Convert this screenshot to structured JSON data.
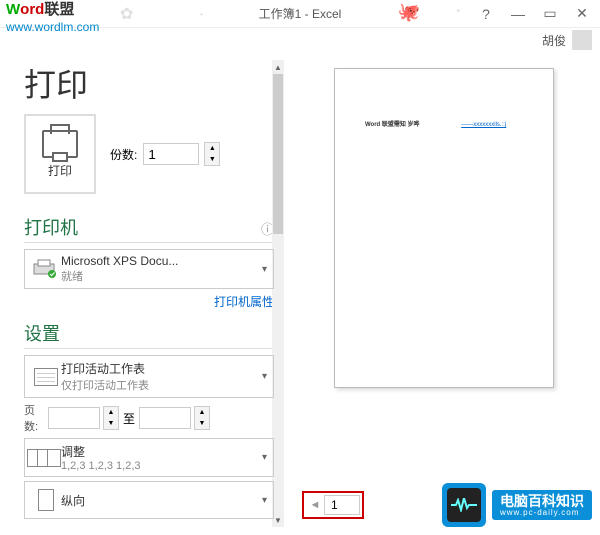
{
  "window": {
    "title": "工作簿1 - Excel",
    "help": "?",
    "min": "—",
    "restore": "▭",
    "close": "✕"
  },
  "user": {
    "name": "胡俊"
  },
  "page": {
    "heading": "打印",
    "print_button": "打印",
    "copies_label": "份数:",
    "copies_value": "1"
  },
  "printer_section": {
    "title": "打印机",
    "selected": "Microsoft XPS Docu...",
    "status": "就绪",
    "properties_link": "打印机属性"
  },
  "settings_section": {
    "title": "设置",
    "scope": {
      "main": "打印活动工作表",
      "sub": "仅打印活动工作表"
    },
    "pages": {
      "label": "页数:",
      "to": "至"
    },
    "collate": {
      "main": "调整",
      "sub": "1,2,3   1,2,3   1,2,3"
    },
    "orientation": {
      "main": "纵向"
    }
  },
  "preview": {
    "line1": "Word 联盟需知 岁哗",
    "line2": "——xxxxxxxlls.::j",
    "page_current": "1",
    "nav_prev": "◄",
    "nav_next": "►"
  },
  "watermark": {
    "brand1": "ord",
    "brand1pre": "W",
    "brand2": "联盟",
    "url": "www.wordlm.com"
  },
  "footer_logo": {
    "title": "电脑百科知识",
    "url": "www.pc-daily.com"
  }
}
